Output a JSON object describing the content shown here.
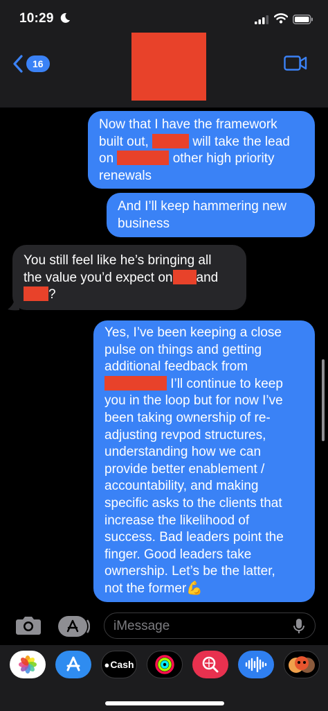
{
  "status_bar": {
    "time": "10:29"
  },
  "header": {
    "back_badge": "16"
  },
  "messages": [
    {
      "type": "outgoing",
      "lines": [
        [
          "Now that I have the framework"
        ],
        [
          "built out, ",
          "[redacted]",
          " will take the lead"
        ],
        [
          "on ",
          "[redacted]",
          " other high priority"
        ],
        [
          "renewals"
        ]
      ]
    },
    {
      "type": "outgoing",
      "lines": [
        [
          "And I’ll keep hammering new"
        ],
        [
          "business"
        ]
      ]
    },
    {
      "type": "incoming",
      "lines": [
        [
          "You still feel like he’s bringing all"
        ],
        [
          "the value you’d expect on",
          "[redacted]",
          "and"
        ],
        [
          "[redacted]",
          "?"
        ]
      ]
    },
    {
      "type": "outgoing",
      "lines": [
        [
          "Yes, I’ve been keeping a close"
        ],
        [
          "pulse on things and getting"
        ],
        [
          "additional feedback from"
        ],
        [
          "[redacted]",
          " I’ll continue to keep"
        ],
        [
          "you in the loop but for now I’ve"
        ],
        [
          "been taking ownership of re-"
        ],
        [
          "adjusting revpod structures,"
        ],
        [
          "understanding how we can"
        ],
        [
          "provide better enablement /"
        ],
        [
          "accountability, and making"
        ],
        [
          "specific asks to the clients that"
        ],
        [
          "increase the likelihood of"
        ],
        [
          "success. Bad leaders point the"
        ],
        [
          "finger. Good leaders take"
        ],
        [
          "ownership. Let’s be the latter,"
        ],
        [
          "not the former",
          "💪"
        ]
      ]
    }
  ],
  "composer": {
    "placeholder": "iMessage"
  },
  "app_drawer": {
    "apps": [
      "photos-icon",
      "app-store-icon",
      "apple-cash-icon",
      "activity-icon",
      "image-search-icon",
      "audio-message-icon",
      "memoji-icon"
    ],
    "cash_label": "Cash"
  },
  "colors": {
    "outgoing_bubble": "#3a82f6",
    "incoming_bubble": "#262629",
    "redaction": "#e8422a",
    "accent": "#3b82f6"
  }
}
